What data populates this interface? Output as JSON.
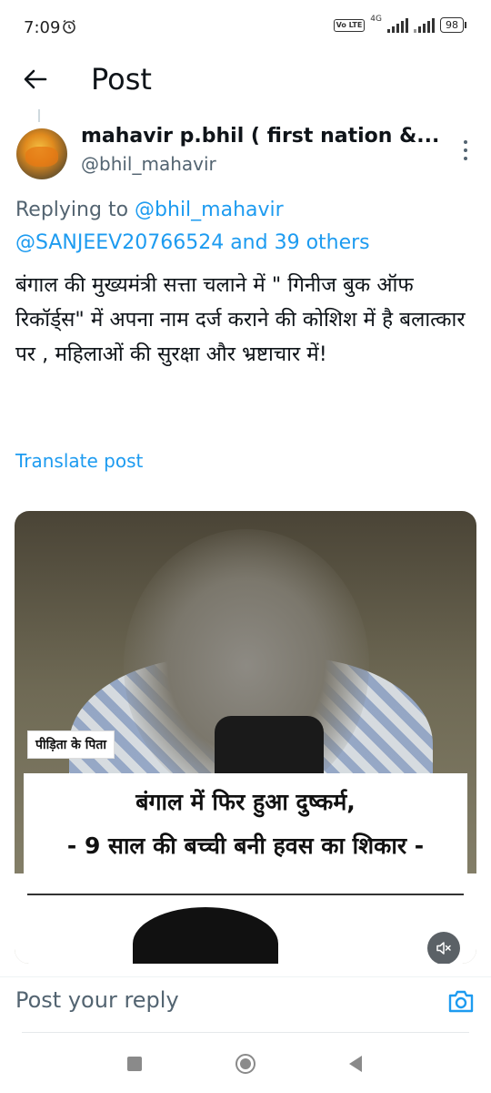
{
  "status_bar": {
    "time": "7:09",
    "network_type": "4G",
    "volte_label": "Vo LTE",
    "battery": "98",
    "icons": [
      "alarm-icon",
      "signal-icon",
      "battery-icon"
    ]
  },
  "header": {
    "title": "Post",
    "back_icon": "back-arrow-icon"
  },
  "post": {
    "display_name": "mahavir p.bhil ( first nation &...",
    "handle": "@bhil_mahavir",
    "replying_prefix": "Replying to",
    "replying_mention_1": "@bhil_mahavir",
    "replying_mention_2": "@SANJEEV20766524",
    "replying_suffix": "and 39 others",
    "text": "बंगाल की मुख्यमंत्री सत्ता चलाने में \" गिनीज बुक ऑफ रिकॉर्ड्स\" में अपना नाम दर्ज कराने की कोशिश में है बलात्कार पर , महिलाओं की सुरक्षा और भ्रष्टाचार में!",
    "translate_label": "Translate post"
  },
  "media": {
    "tag_label": "पीड़िता के पिता",
    "headline_line1": "बंगाल में फिर हुआ दुष्कर्म,",
    "headline_line2": "- 9 साल की बच्ची बनी हवस का शिकार -",
    "mute_icon": "volume-muted-icon"
  },
  "reply_bar": {
    "placeholder": "Post your reply",
    "camera_icon": "camera-icon"
  },
  "colors": {
    "accent": "#1d9bf0",
    "secondary_text": "#536471",
    "primary_text": "#0f1419"
  }
}
